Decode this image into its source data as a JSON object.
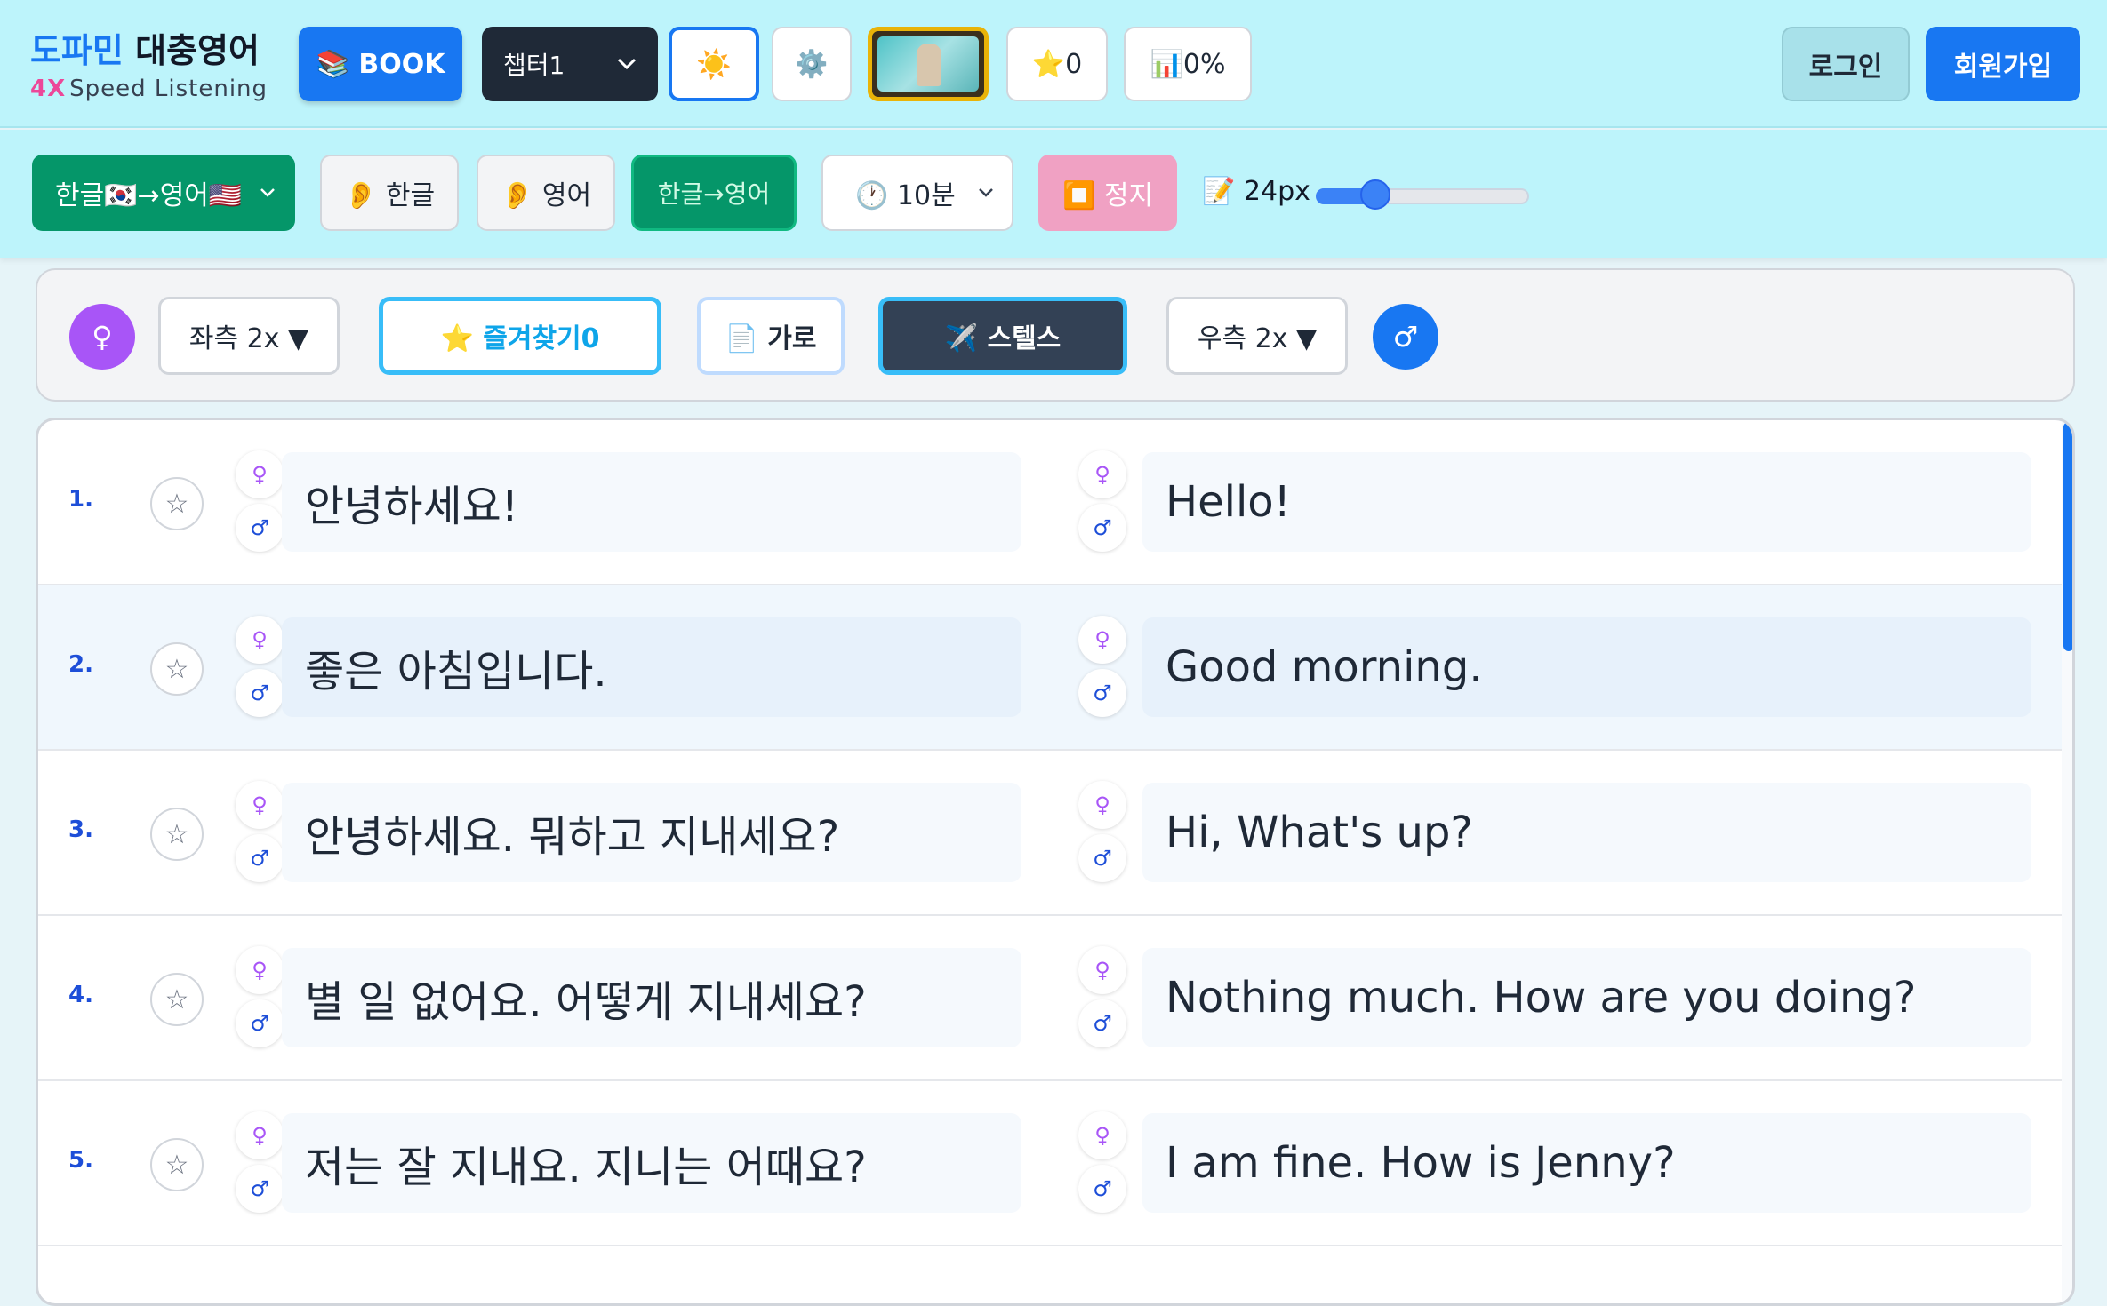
{
  "header": {
    "brand": "도파민",
    "brand_rest": " 대충영어",
    "sub_prefix": "4X",
    "sub": "Speed Listening",
    "book_label": "📚 BOOK",
    "chapter": "챕터1",
    "sun_icon": "☀️",
    "gear_icon": "⚙️",
    "star_count": "⭐0",
    "progress": "📊0%",
    "login": "로그인",
    "signup": "회원가입"
  },
  "controls": {
    "lang_mode": "한글🇰🇷→영어🇺🇸",
    "kor": "👂 한글",
    "eng": "👂 영어",
    "both": "한글→영어",
    "time": "🕐 10분",
    "stop": "⏹️ 정지",
    "font_size": "📝 24px",
    "font_slider_fraction": 0.28
  },
  "options": {
    "female_icon": "♀",
    "left_speed": "좌측 2x ▼",
    "favorites": "⭐ 즐겨찾기0",
    "layout": "📄 가로",
    "stealth": "✈️ 스텔스",
    "right_speed": "우측 2x ▼",
    "male_icon": "♂"
  },
  "rows": [
    {
      "num": "1.",
      "ko": "안녕하세요!",
      "en": "Hello!"
    },
    {
      "num": "2.",
      "ko": "좋은 아침입니다.",
      "en": "Good morning."
    },
    {
      "num": "3.",
      "ko": "안녕하세요. 뭐하고 지내세요?",
      "en": "Hi, What's up?"
    },
    {
      "num": "4.",
      "ko": "별 일 없어요. 어떻게 지내세요?",
      "en": "Nothing much. How are you doing?"
    },
    {
      "num": "5.",
      "ko": "저는 잘 지내요. 지니는 어때요?",
      "en": "I am fine. How is Jenny?"
    }
  ],
  "row_icons": {
    "star": "☆",
    "female": "♀",
    "male": "♂"
  },
  "colors": {
    "accent": "#1877f2",
    "toolbar_bg": "#bdf4fb",
    "green": "#059669"
  }
}
